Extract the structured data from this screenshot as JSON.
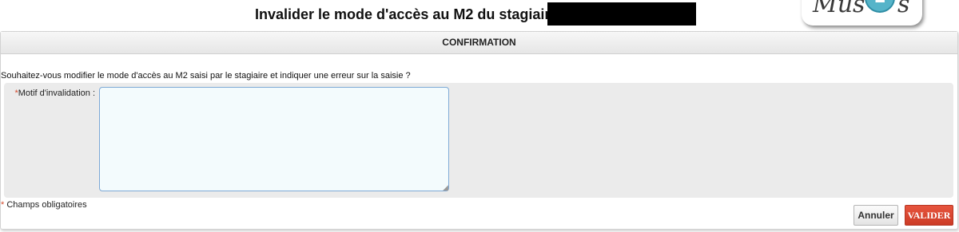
{
  "header": {
    "title": "Invalider le mode d'accès au M2 du stagiaire",
    "logo_text": "Mus",
    "logo_letter": "E",
    "logo_suffix": "s"
  },
  "panel": {
    "heading": "CONFIRMATION",
    "question": "Souhaitez-vous modifier le mode d'accès au M2 saisi par le stagiaire et indiquer une erreur sur la saisie ?",
    "field": {
      "required_mark": "*",
      "label": "Motif d'invalidation :",
      "value": ""
    },
    "required_note": {
      "mark": "*",
      "text": " Champs obligatoires"
    }
  },
  "buttons": {
    "cancel": "Annuler",
    "submit": "VALIDER"
  },
  "colors": {
    "required": "#d44a2c",
    "submit_bg": "#d9462f",
    "textarea_border": "#7ea9d6",
    "form_bg": "#ebebeb"
  }
}
